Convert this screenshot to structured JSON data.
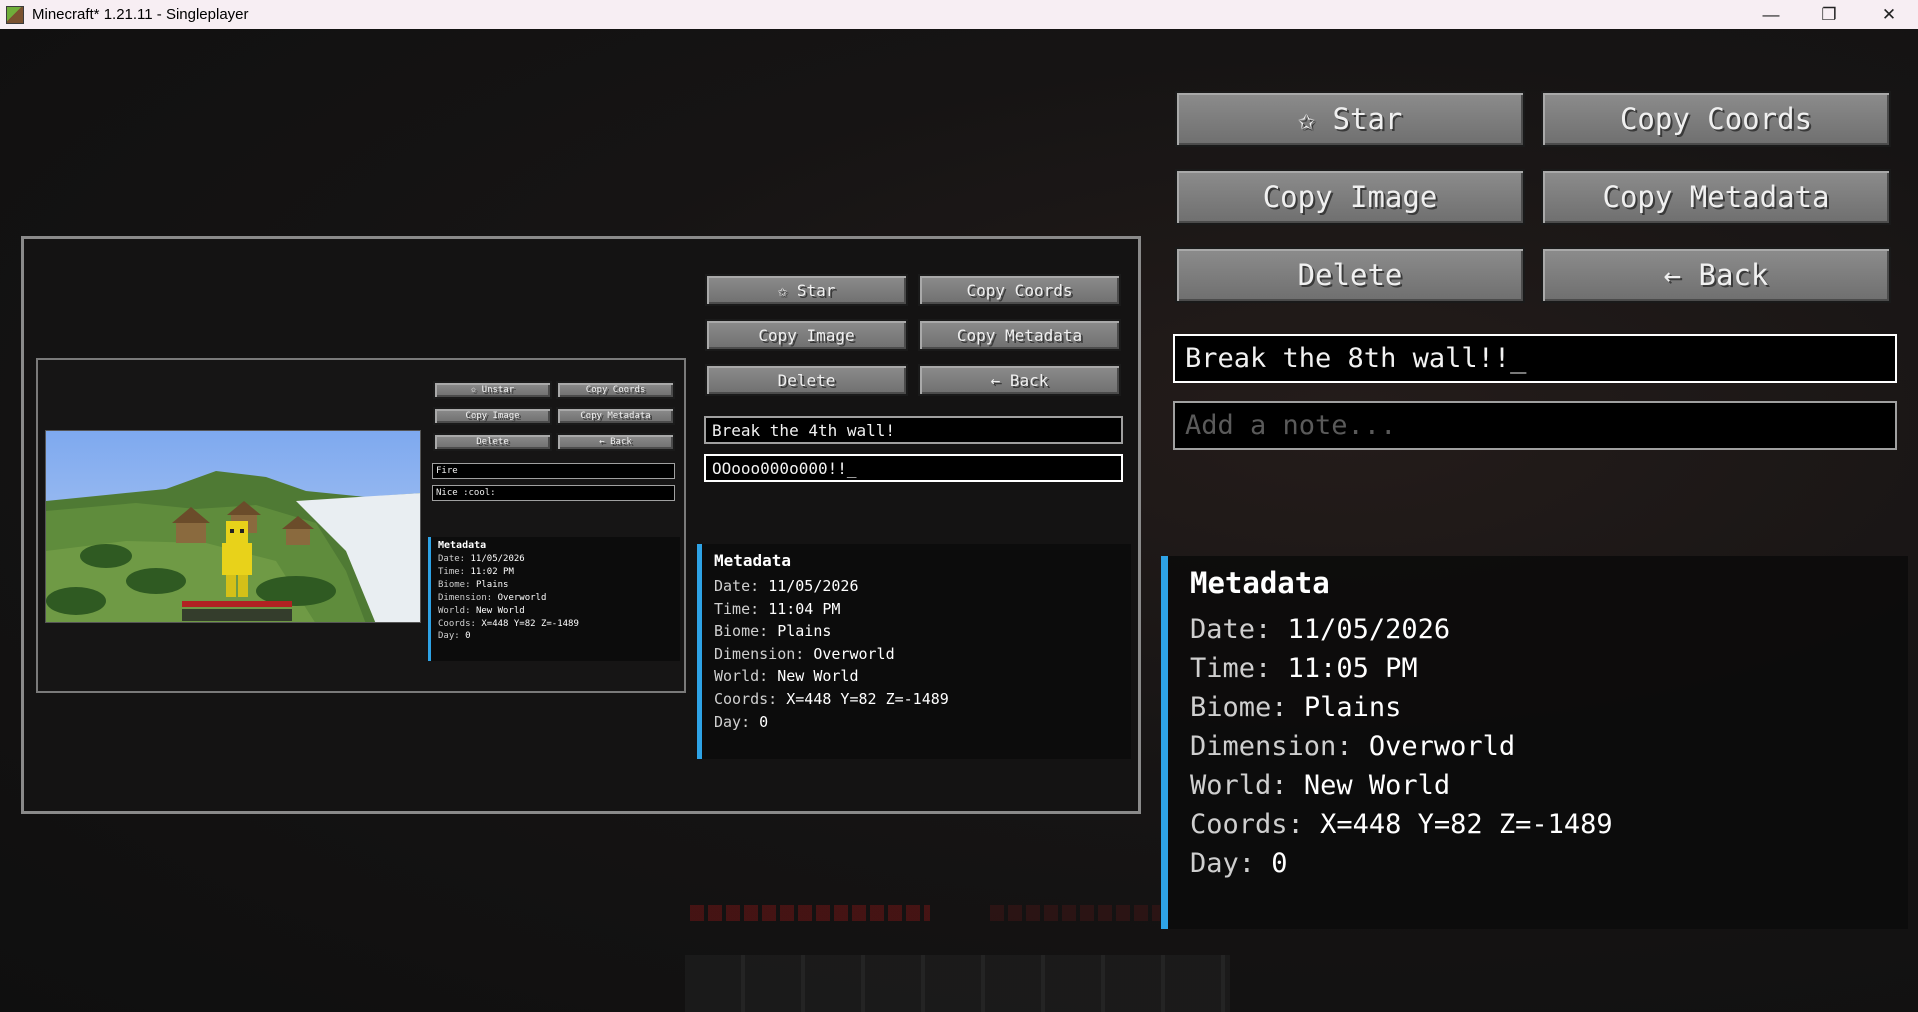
{
  "window": {
    "title": "Minecraft* 1.21.11 - Singleplayer",
    "minimize": "—",
    "maximize": "❐",
    "close": "✕"
  },
  "main": {
    "buttons": {
      "star": "✩ Star",
      "copy_coords": "Copy Coords",
      "copy_image": "Copy Image",
      "copy_metadata": "Copy Metadata",
      "delete": "Delete",
      "back": "← Back"
    },
    "title_input": "Break the 8th wall!!_",
    "note_placeholder": "Add a note...",
    "metadata": {
      "heading": "Metadata",
      "date_label": "Date:",
      "date": "11/05/2026",
      "time_label": "Time:",
      "time": "11:05 PM",
      "biome_label": "Biome:",
      "biome": "Plains",
      "dimension_label": "Dimension:",
      "dimension": "Overworld",
      "world_label": "World:",
      "world": "New World",
      "coords_label": "Coords:",
      "coords": "X=448 Y=82 Z=-1489",
      "day_label": "Day:",
      "day": "0"
    }
  },
  "level1": {
    "buttons": {
      "star": "✩ Star",
      "copy_coords": "Copy Coords",
      "copy_image": "Copy Image",
      "copy_metadata": "Copy Metadata",
      "delete": "Delete",
      "back": "← Back"
    },
    "title_input": "Break the 4th wall!",
    "note_input": "OOooo000o000!!_",
    "metadata": {
      "heading": "Metadata",
      "date_label": "Date:",
      "date": "11/05/2026",
      "time_label": "Time:",
      "time": "11:04 PM",
      "biome_label": "Biome:",
      "biome": "Plains",
      "dimension_label": "Dimension:",
      "dimension": "Overworld",
      "world_label": "World:",
      "world": "New World",
      "coords_label": "Coords:",
      "coords": "X=448 Y=82 Z=-1489",
      "day_label": "Day:",
      "day": "0"
    }
  },
  "level2": {
    "buttons": {
      "star": "✩ Unstar",
      "copy_coords": "Copy Coords",
      "copy_image": "Copy Image",
      "copy_metadata": "Copy Metadata",
      "delete": "Delete",
      "back": "← Back"
    },
    "title_input": "Fire",
    "note_input": "Nice :cool:",
    "metadata": {
      "heading": "Metadata",
      "date_label": "Date:",
      "date": "11/05/2026",
      "time_label": "Time:",
      "time": "11:02 PM",
      "biome_label": "Biome:",
      "biome": "Plains",
      "dimension_label": "Dimension:",
      "dimension": "Overworld",
      "world_label": "World:",
      "world": "New World",
      "coords_label": "Coords:",
      "coords": "X=448 Y=82 Z=-1489",
      "day_label": "Day:",
      "day": "0"
    }
  },
  "colors": {
    "accent": "#2ea3e6",
    "button": "#7c7c7c",
    "background": "#121212"
  }
}
